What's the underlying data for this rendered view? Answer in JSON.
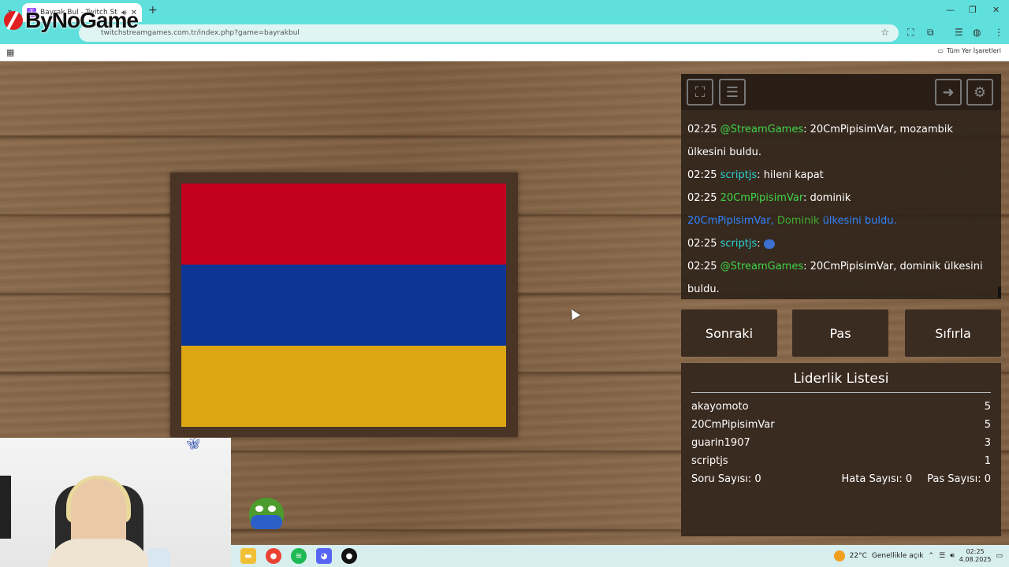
{
  "browser": {
    "tab_title": "Bayrak Bul - Twitch Stream",
    "url": "twitchstreamgames.com.tr/index.php?game=bayrakbul",
    "bookmarks_folder": "Tüm Yer İşaretleri"
  },
  "overlay": {
    "logo_text": "ByNoGame"
  },
  "game": {
    "flag_colors": [
      "#c4001f",
      "#0e3596",
      "#dca613"
    ]
  },
  "chat": {
    "messages": [
      {
        "time": "02:25",
        "user": "@StreamGames",
        "text": ": 20CmPipisimVar, mozambik ülkesini buldu."
      },
      {
        "time": "02:25",
        "user": "scriptjs",
        "text": ": hileni kapat"
      },
      {
        "time": "02:25",
        "user": "20CmPipisimVar",
        "text": ": dominik"
      },
      {
        "system_user": "20CmPipisimVar,",
        "system_country": "Dominik",
        "system_text": "ülkesini buldu."
      },
      {
        "time": "02:25",
        "user": "scriptjs",
        "text": ":"
      },
      {
        "time": "02:25",
        "user": "@StreamGames",
        "text": ": 20CmPipisimVar, dominik ülkesini buldu."
      }
    ]
  },
  "controls": {
    "next": "Sonraki",
    "pass": "Pas",
    "reset": "Sıfırla"
  },
  "leaderboard": {
    "title": "Liderlik Listesi",
    "rows": [
      {
        "name": "akayomoto",
        "score": "5"
      },
      {
        "name": "20CmPipisimVar",
        "score": "5"
      },
      {
        "name": "guarin1907",
        "score": "3"
      },
      {
        "name": "scriptjs",
        "score": "1"
      }
    ],
    "question_count_label": "Soru Sayısı:",
    "question_count": "0",
    "error_count_label": "Hata Sayısı:",
    "error_count": "0",
    "pass_count_label": "Pas Sayısı:",
    "pass_count": "0"
  },
  "taskbar": {
    "weather": "22°C",
    "weather_desc": "Genellikle açık",
    "time": "02:25",
    "date": "4.08.2025"
  }
}
